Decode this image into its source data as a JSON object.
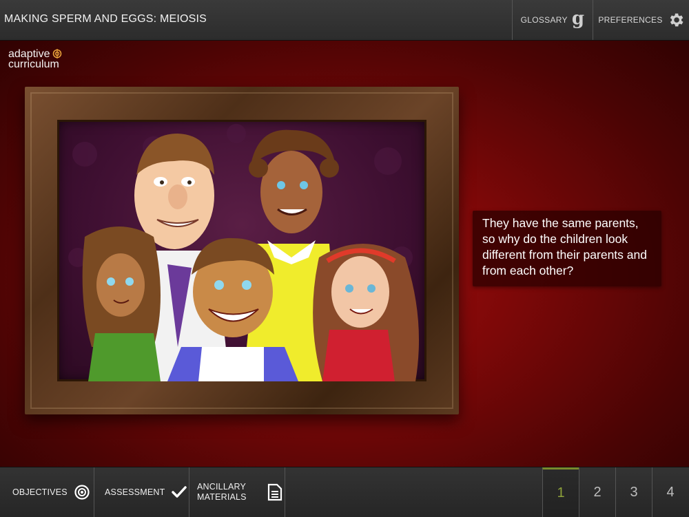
{
  "header": {
    "title": "MAKING SPERM AND EGGS: MEIOSIS",
    "glossary_label": "GLOSSARY",
    "preferences_label": "PREFERENCES"
  },
  "logo": {
    "line1": "adaptive",
    "line2": "curriculum"
  },
  "question": {
    "text": "They have the same parents, so why do the children look different from their parents and from each other?"
  },
  "footer": {
    "objectives_label": "OBJECTIVES",
    "assessment_label": "ASSESSMENT",
    "ancillary_line1": "ANCILLARY",
    "ancillary_line2": "MATERIALS"
  },
  "pagination": {
    "pages": [
      "1",
      "2",
      "3",
      "4"
    ],
    "active": "1"
  },
  "colors": {
    "accent_page": "#8ea23a",
    "stage_red": "#8a0b0b"
  },
  "icons": {
    "glossary": "glossary-g-icon",
    "preferences": "gear-icon",
    "objectives": "target-icon",
    "assessment": "checkmark-icon",
    "ancillary": "document-icon"
  }
}
